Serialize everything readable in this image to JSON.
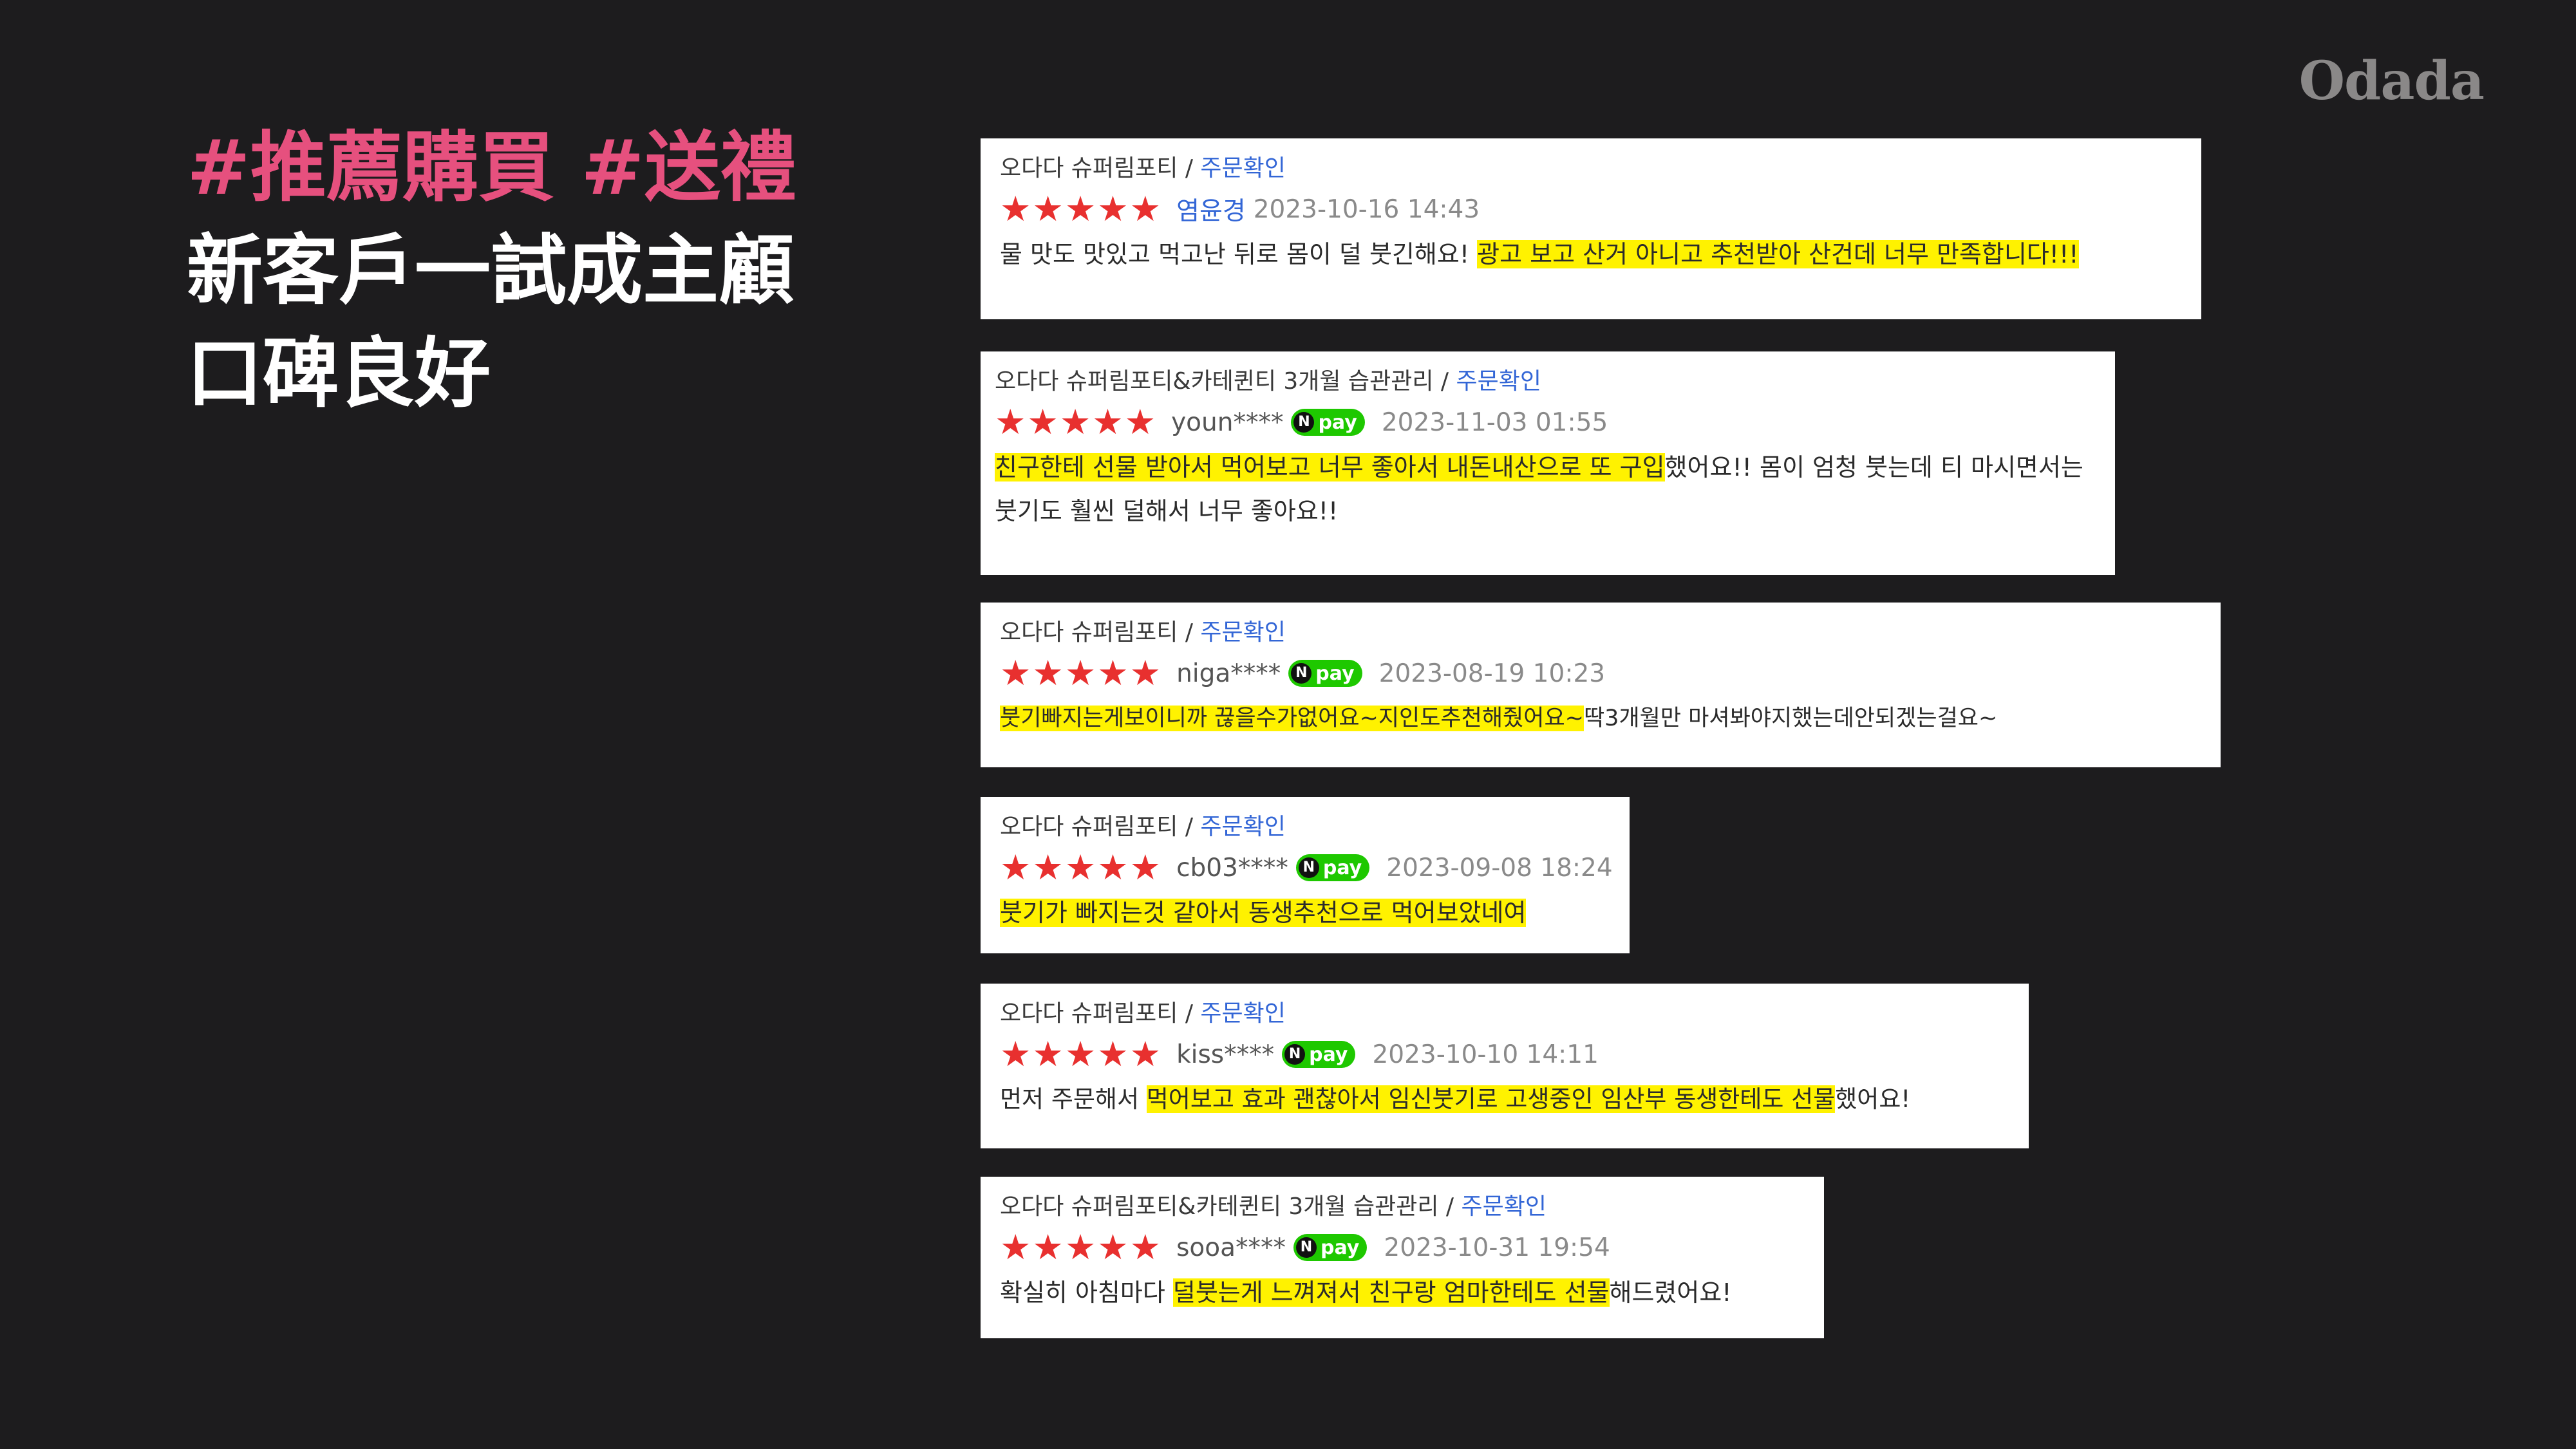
{
  "logo": "Odada",
  "headline": {
    "tags": "#推薦購買 #送禮",
    "line1": "新客戶一試成主顧",
    "line2": "口碑良好"
  },
  "reviews": [
    {
      "product": "오다다 슈퍼림포티",
      "confirm": "주문확인",
      "stars": "★★★★★",
      "user": "염윤경",
      "date": "2023-10-16 14:43",
      "text_before": "물 맛도 맛있고 먹고난 뒤로 몸이 덜 붓긴해요! ",
      "text_highlight": "광고 보고 산거 아니고 추천받아 산건데 너무 만족합니다!!!",
      "text_after": ""
    },
    {
      "product": "오다다 슈퍼림포티&카테퀸티 3개월 습관관리",
      "confirm": "주문확인",
      "stars": "★★★★★",
      "user": "youn****",
      "npay": "pay",
      "date": "2023-11-03 01:55",
      "text_before": "",
      "text_highlight": "친구한테 선물 받아서 먹어보고 너무 좋아서 내돈내산으로 또 구입",
      "text_after": "했어요!! 몸이 엄청 붓는데 티 마시면서는 붓기도 훨씬 덜해서 너무 좋아요!!"
    },
    {
      "product": "오다다 슈퍼림포티",
      "confirm": "주문확인",
      "stars": "★★★★★",
      "user": "niga****",
      "npay": "pay",
      "date": "2023-08-19 10:23",
      "text_before": "",
      "text_highlight": "붓기빠지는게보이니까 끊을수가없어요~지인도추천해줬어요~",
      "text_after": "딱3개월만 마셔봐야지했는데안되겠는걸요~"
    },
    {
      "product": "오다다 슈퍼림포티",
      "confirm": "주문확인",
      "stars": "★★★★★",
      "user": "cb03****",
      "npay": "pay",
      "date": "2023-09-08 18:24",
      "text_before": "",
      "text_highlight": "붓기가 빠지는것 같아서 동생추천으로 먹어보았네여",
      "text_after": ""
    },
    {
      "product": "오다다 슈퍼림포티",
      "confirm": "주문확인",
      "stars": "★★★★★",
      "user": "kiss****",
      "npay": "pay",
      "date": "2023-10-10 14:11",
      "text_before": "먼저 주문해서 ",
      "text_highlight": "먹어보고 효과 괜찮아서 임신붓기로 고생중인 임산부 동생한테도 선물",
      "text_after": "했어요!"
    },
    {
      "product": "오다다 슈퍼림포티&카테퀸티 3개월 습관관리",
      "confirm": "주문확인",
      "stars": "★★★★★",
      "user": "sooa****",
      "npay": "pay",
      "date": "2023-10-31 19:54",
      "text_before": "확실히 아침마다 ",
      "text_highlight": "덜붓는게 느껴져서 친구랑 엄마한테도 선물",
      "text_after": "해드렸어요!"
    }
  ]
}
